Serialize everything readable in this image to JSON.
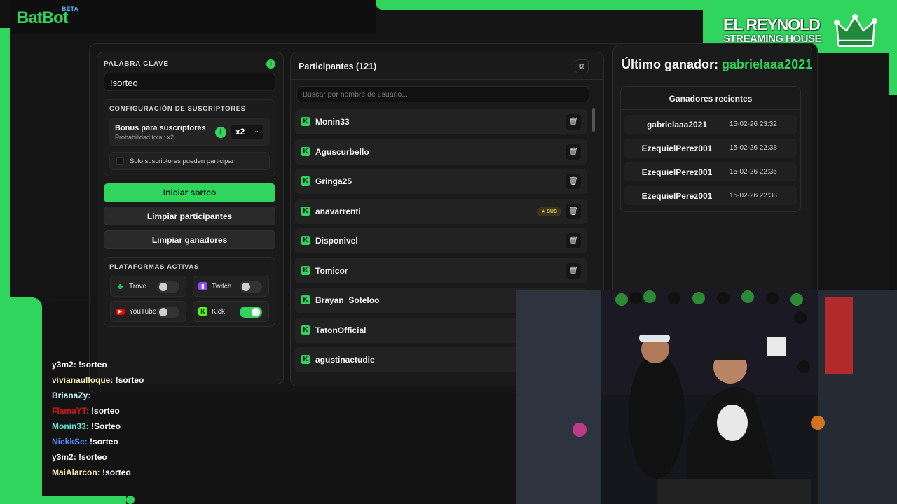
{
  "logo": {
    "text": "BatBot",
    "badge": "BETA"
  },
  "brand": {
    "line1": "EL REYNOLD",
    "line2": "STREAMING HOUSE"
  },
  "keyword": {
    "label": "PALABRA CLAVE",
    "value": "!sorteo"
  },
  "subscribers": {
    "section_label": "CONFIGURACIÓN DE SUSCRIPTORES",
    "bonus_title": "Bonus para suscriptores",
    "bonus_subtitle": "Probabilidad total: x2",
    "multiplier": "x2",
    "only_subs_label": "Solo suscriptores pueden participar"
  },
  "actions": {
    "start": "Iniciar sorteo",
    "clear_participants": "Limpiar participantes",
    "clear_winners": "Limpiar ganadores"
  },
  "platforms": {
    "section_label": "PLATAFORMAS ACTIVAS",
    "items": [
      {
        "name": "Trovo",
        "enabled": false,
        "color": "#22c55e"
      },
      {
        "name": "Twitch",
        "enabled": false,
        "color": "#9146ff"
      },
      {
        "name": "YouTube",
        "enabled": false,
        "color": "#ff0000"
      },
      {
        "name": "Kick",
        "enabled": true,
        "color": "#53fc18"
      }
    ]
  },
  "participants": {
    "title": "Participantes (121)",
    "search_placeholder": "Buscar por nombre de usuario...",
    "sub_badge": "SUB",
    "rows": [
      {
        "name": "Monin33",
        "sub": false
      },
      {
        "name": "Aguscurbello",
        "sub": false
      },
      {
        "name": "Gringa25",
        "sub": false
      },
      {
        "name": "anavarrenti",
        "sub": true
      },
      {
        "name": "Disponivel",
        "sub": false
      },
      {
        "name": "Tomicor",
        "sub": false
      },
      {
        "name": "Brayan_Soteloo",
        "sub": false
      },
      {
        "name": "TatonOfficial",
        "sub": false
      },
      {
        "name": "agustinaetudie",
        "sub": false
      }
    ]
  },
  "last_winner": {
    "label": "Último ganador:",
    "name": "gabrielaaa2021"
  },
  "recent_winners": {
    "title": "Ganadores recientes",
    "rows": [
      {
        "name": "gabrielaaa2021",
        "time": "15-02-26 23:32"
      },
      {
        "name": "EzequielPerez001",
        "time": "15-02-26 22:38"
      },
      {
        "name": "EzequielPerez001",
        "time": "15-02-26 22:35"
      },
      {
        "name": "EzequielPerez001",
        "time": "15-02-26 22:38"
      }
    ]
  },
  "chat": [
    {
      "user": "y3m2:",
      "msg": "!sorteo",
      "color": "#ffffff"
    },
    {
      "user": "vivianaulloque:",
      "msg": "!sorteo",
      "color": "#f5e6a8"
    },
    {
      "user": "BrianaZy:",
      "msg": "",
      "color": "#bff2ff"
    },
    {
      "user": "FlamaYT:",
      "msg": "!sorteo",
      "color": "#d01818"
    },
    {
      "user": "Monin33:",
      "msg": "!Sorteo",
      "color": "#5ee6d8"
    },
    {
      "user": "NickkSc:",
      "msg": "!sorteo",
      "color": "#4f8cff"
    },
    {
      "user": "y3m2:",
      "msg": "!sorteo",
      "color": "#ffffff"
    },
    {
      "user": "MaiAlarcon:",
      "msg": "!sorteo",
      "color": "#f5e6a8"
    }
  ],
  "colors": {
    "accent": "#2fd55c",
    "background": "#111111",
    "panel": "#1a1a1a"
  }
}
